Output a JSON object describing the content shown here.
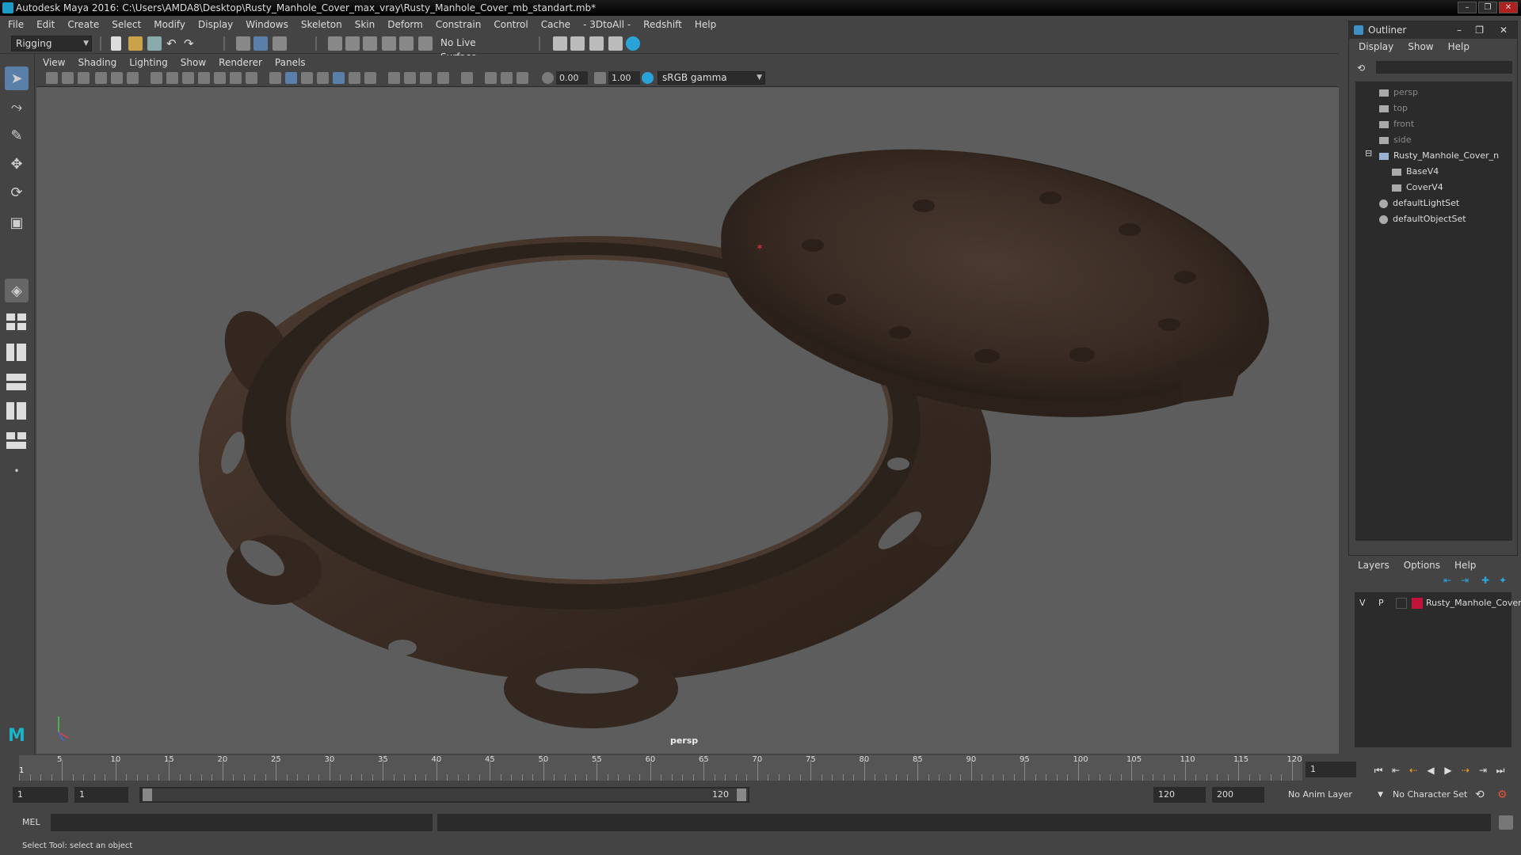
{
  "window": {
    "title": "Autodesk Maya 2016: C:\\Users\\AMDA8\\Desktop\\Rusty_Manhole_Cover_max_vray\\Rusty_Manhole_Cover_mb_standart.mb*",
    "minimize": "–",
    "maximize": "❐",
    "close": "✕"
  },
  "menubar": [
    "File",
    "Edit",
    "Create",
    "Select",
    "Modify",
    "Display",
    "Windows",
    "Skeleton",
    "Skin",
    "Deform",
    "Constrain",
    "Control",
    "Cache",
    "- 3DtoAll -",
    "Redshift",
    "Help"
  ],
  "shelf": {
    "mode": "Rigging",
    "live_surface": "No Live Surface"
  },
  "viewport": {
    "menu": [
      "View",
      "Shading",
      "Lighting",
      "Show",
      "Renderer",
      "Panels"
    ],
    "exposure": "0.00",
    "gamma": "1.00",
    "colorspace": "sRGB gamma",
    "camera_label": "persp"
  },
  "outliner": {
    "title": "Outliner",
    "menu": [
      "Display",
      "Show",
      "Help"
    ],
    "items": [
      {
        "label": "persp",
        "type": "camera",
        "dim": true
      },
      {
        "label": "top",
        "type": "camera",
        "dim": true
      },
      {
        "label": "front",
        "type": "camera",
        "dim": true
      },
      {
        "label": "side",
        "type": "camera",
        "dim": true
      },
      {
        "label": "Rusty_Manhole_Cover_n",
        "type": "group",
        "dim": false
      },
      {
        "label": "BaseV4",
        "type": "mesh",
        "dim": false
      },
      {
        "label": "CoverV4",
        "type": "mesh",
        "dim": false
      },
      {
        "label": "defaultLightSet",
        "type": "set",
        "dim": false
      },
      {
        "label": "defaultObjectSet",
        "type": "set",
        "dim": false
      }
    ]
  },
  "layers": {
    "menu": [
      "Layers",
      "Options",
      "Help"
    ],
    "rows": [
      {
        "v": "V",
        "p": "P",
        "color": "#c0143c",
        "name": "Rusty_Manhole_Cover"
      }
    ]
  },
  "timeline": {
    "ticks": [
      5,
      10,
      15,
      20,
      25,
      30,
      35,
      40,
      45,
      50,
      55,
      60,
      65,
      70,
      75,
      80,
      85,
      90,
      95,
      100,
      105,
      110,
      115,
      120
    ],
    "first_label": "1",
    "current_frame": "1"
  },
  "range": {
    "start": "1",
    "start2": "1",
    "slider_start": "1",
    "slider_end": "120",
    "end": "120",
    "end2": "200",
    "anim_layer": "No Anim Layer",
    "char_set": "No Character Set"
  },
  "command": {
    "label": "MEL"
  },
  "status": "Select Tool: select an object"
}
